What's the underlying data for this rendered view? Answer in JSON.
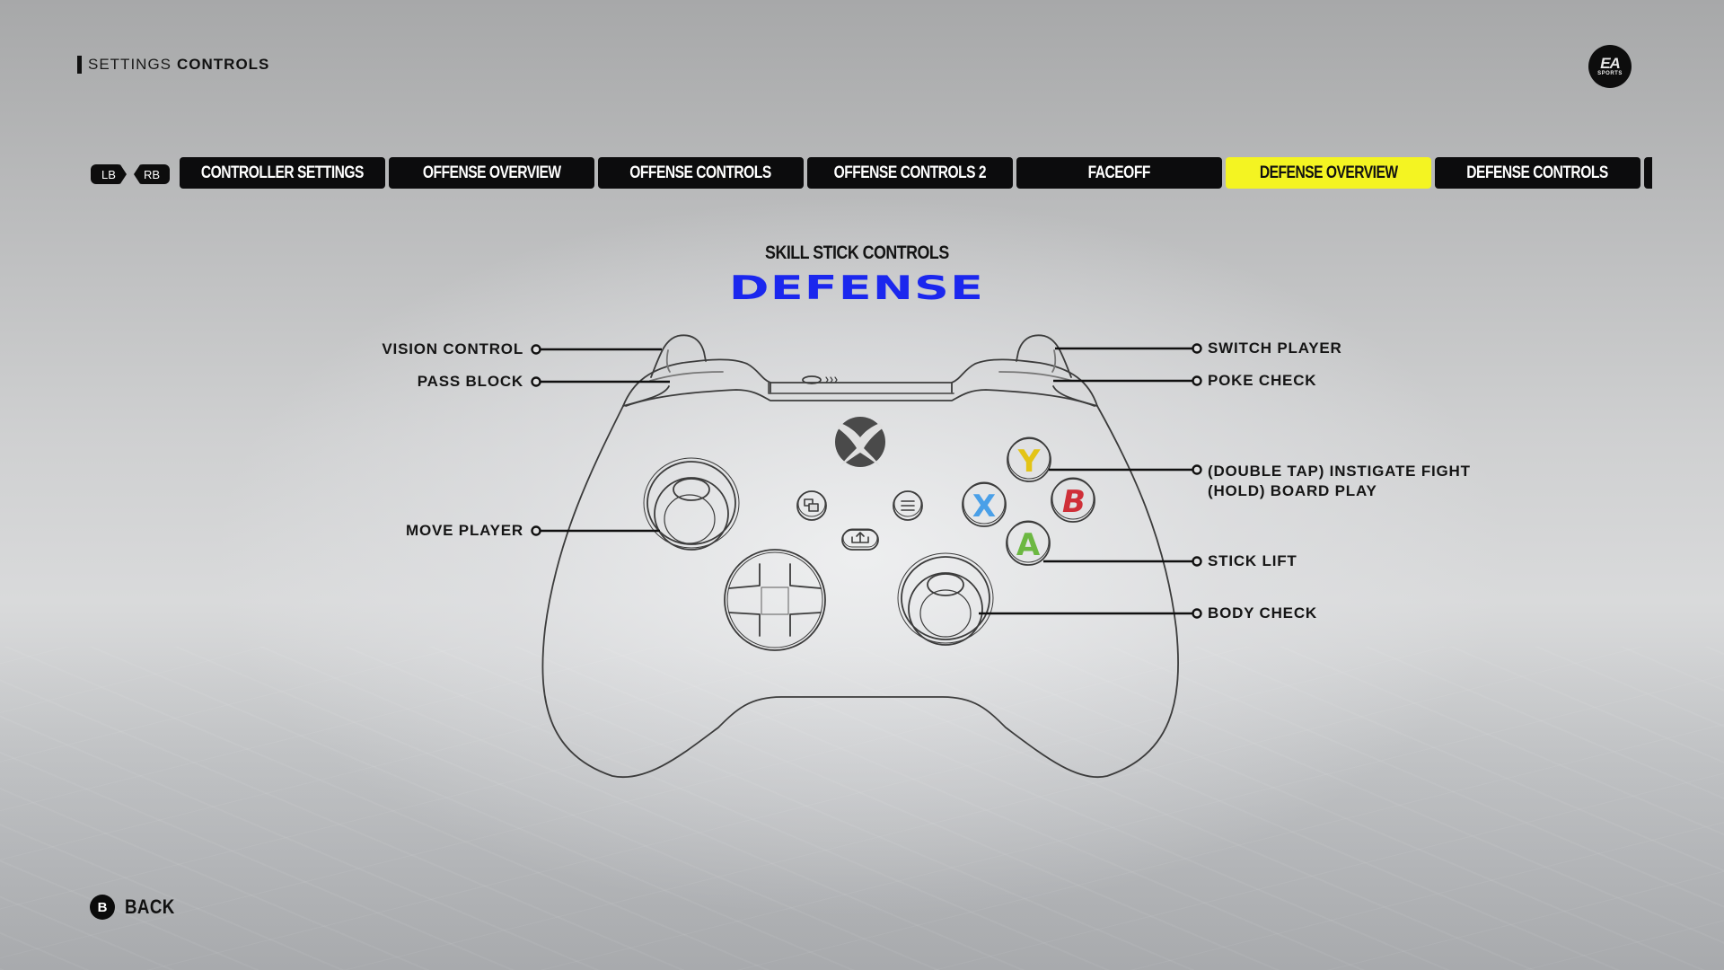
{
  "breadcrumb": {
    "section": "SETTINGS",
    "page": "CONTROLS"
  },
  "brand": {
    "logo_top": "EA",
    "logo_bottom": "SPORTS"
  },
  "bumpers": {
    "left": "LB",
    "right": "RB"
  },
  "tabs": [
    {
      "label": "CONTROLLER SETTINGS",
      "active": false
    },
    {
      "label": "OFFENSE OVERVIEW",
      "active": false
    },
    {
      "label": "OFFENSE CONTROLS",
      "active": false
    },
    {
      "label": "OFFENSE CONTROLS 2",
      "active": false
    },
    {
      "label": "FACEOFF",
      "active": false
    },
    {
      "label": "DEFENSE OVERVIEW",
      "active": true
    },
    {
      "label": "DEFENSE CONTROLS",
      "active": false
    }
  ],
  "colors": {
    "active_tab": "#f4f422",
    "title": "#1b27ee",
    "y_button": "#e3c416",
    "x_button": "#4aa0e8",
    "b_button": "#cf2f38",
    "a_button": "#6cb842"
  },
  "header": {
    "subtitle": "SKILL STICK CONTROLS",
    "title": "DEFENSE"
  },
  "controller": {
    "face_buttons": {
      "y": "Y",
      "x": "X",
      "b": "B",
      "a": "A"
    }
  },
  "callouts": {
    "left": [
      {
        "id": "lb",
        "label": "VISION CONTROL"
      },
      {
        "id": "lt",
        "label": "PASS BLOCK"
      },
      {
        "id": "ls",
        "label": "MOVE PLAYER"
      }
    ],
    "right": [
      {
        "id": "rb",
        "label": "SWITCH PLAYER"
      },
      {
        "id": "rt",
        "label": "POKE CHECK"
      },
      {
        "id": "y",
        "label": "(DOUBLE TAP) INSTIGATE FIGHT",
        "label2": "(HOLD) BOARD PLAY"
      },
      {
        "id": "a",
        "label": "STICK LIFT"
      },
      {
        "id": "rs",
        "label": "BODY CHECK"
      }
    ]
  },
  "footer": {
    "back_button": "B",
    "back_label": "BACK"
  }
}
